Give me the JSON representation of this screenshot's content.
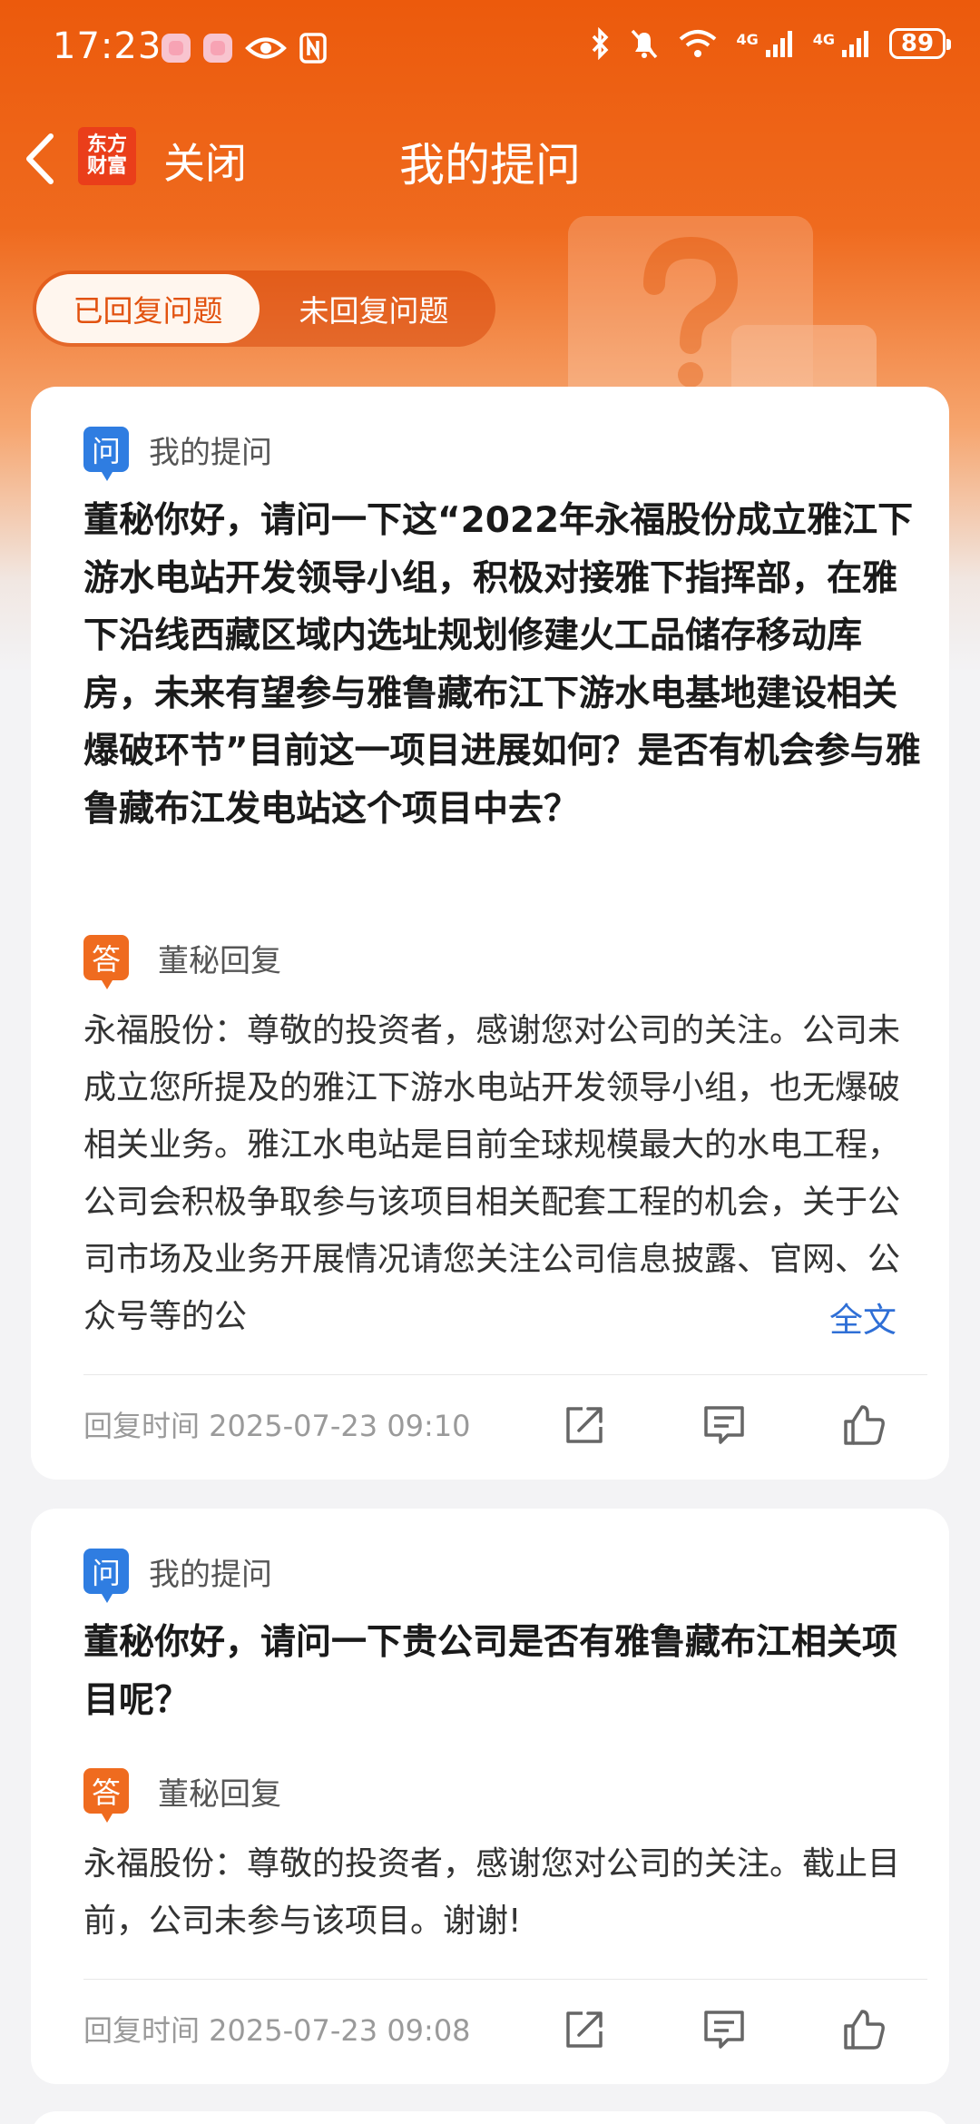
{
  "status_bar": {
    "time": "17:23",
    "net1": "4G",
    "net2": "4G",
    "battery": "89"
  },
  "nav": {
    "brand_line1": "东方",
    "brand_line2": "财富",
    "close_label": "关闭",
    "title": "我的提问"
  },
  "tabs": [
    {
      "label": "已回复问题",
      "active": true
    },
    {
      "label": "未回复问题",
      "active": false
    }
  ],
  "cards": [
    {
      "q_badge": "问",
      "q_label": "我的提问",
      "question": "董秘你好，请问一下这“2022年永福股份成立雅江下游水电站开发领导小组，积极对接雅下指挥部，在雅下沿线西藏区域内选址规划修建火工品储存移动库房，未来有望参与雅鲁藏布江下游水电基地建设相关爆破环节”目前这一项目进展如何？是否有机会参与雅鲁藏布江发电站这个项目中去？",
      "a_badge": "答",
      "a_label": "董秘回复",
      "answer": "永福股份：尊敬的投资者，感谢您对公司的关注。公司未成立您所提及的雅江下游水电站开发领导小组，也无爆破相关业务。雅江水电站是目前全球规模最大的水电工程，公司会积极争取参与该项目相关配套工程的机会，关于公司市场及业务开展情况请您关注公司信息披露、官网、公众号等的公",
      "full_text_link": "全文",
      "reply_time": "回复时间 2025-07-23 09:10"
    },
    {
      "q_badge": "问",
      "q_label": "我的提问",
      "question": "董秘你好，请问一下贵公司是否有雅鲁藏布江相关项目呢？",
      "a_badge": "答",
      "a_label": "董秘回复",
      "answer": "永福股份：尊敬的投资者，感谢您对公司的关注。截止目前，公司未参与该项目。谢谢!",
      "reply_time": "回复时间 2025-07-23 09:08"
    }
  ],
  "icons": {
    "back": "back-arrow-icon",
    "share": "share-icon",
    "comment": "comment-icon",
    "like": "thumbs-up-icon"
  },
  "colors": {
    "brand_orange": "#ec5a0c",
    "question_badge": "#2f7de1",
    "answer_badge": "#ef6b1f",
    "link_blue": "#2f6fd6"
  }
}
